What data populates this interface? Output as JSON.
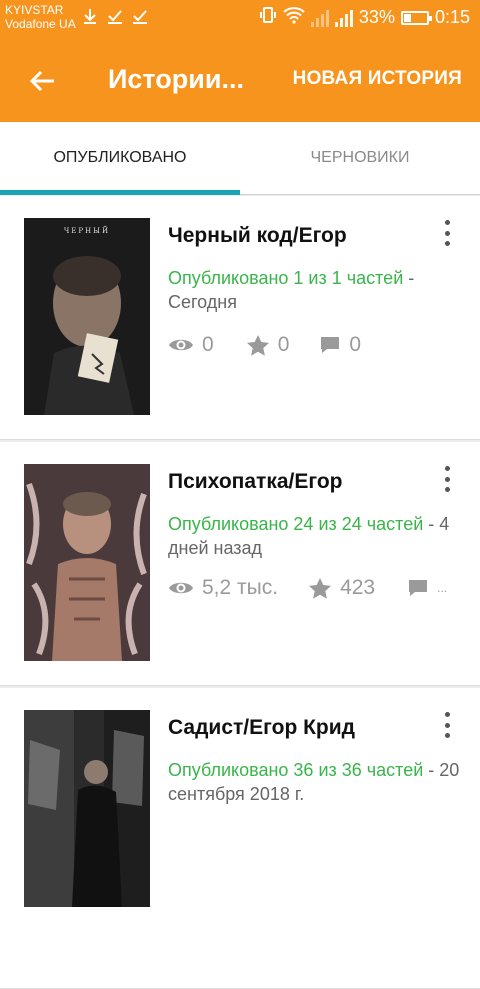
{
  "status_bar": {
    "carrier_1": "KYIVSTAR",
    "carrier_2": "Vodafone UA",
    "battery": "33%",
    "battery_level": 0.33,
    "time": "0:15"
  },
  "app_bar": {
    "title": "Истории...",
    "new_story_label": "НОВАЯ ИСТОРИЯ"
  },
  "tabs": [
    {
      "label": "ОПУБЛИКОВАНО",
      "active": true
    },
    {
      "label": "ЧЕРНОВИКИ",
      "active": false
    }
  ],
  "stories": [
    {
      "title": "Черный код/Егор",
      "cover_text": "ЧЕРНЫЙ",
      "published": "Опубликовано 1 из 1 частей",
      "separator": " - ",
      "date": "Сегодня",
      "views": "0",
      "votes": "0",
      "comments": "0"
    },
    {
      "title": "Психопатка/Егор",
      "published": "Опубликовано 24 из 24 частей",
      "separator": " - ",
      "date": "4 дней назад",
      "views": "5,2 тыс.",
      "votes": "423",
      "comments": "..."
    },
    {
      "title": "Садист/Егор Крид",
      "published": "Опубликовано 36 из 36 частей",
      "separator": " - ",
      "date": "20 сентября 2018 г."
    }
  ],
  "colors": {
    "accent": "#f7941d",
    "tab_indicator": "#1aa3b4",
    "published_green": "#39b54a"
  }
}
